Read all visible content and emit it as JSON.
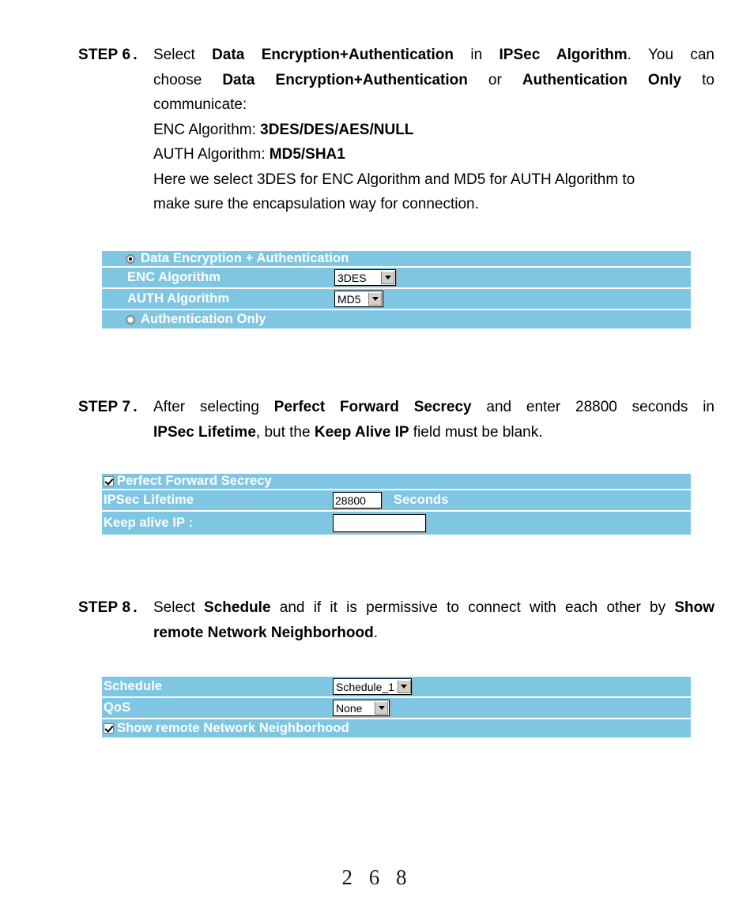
{
  "document": {
    "page_number": "2 6 8"
  },
  "steps": [
    {
      "label": "STEP 6",
      "separator": ".",
      "lines": [
        [
          {
            "t": "Select ",
            "b": false
          },
          {
            "t": "Data Encryption+Authentication",
            "b": true
          },
          {
            "t": " in ",
            "b": false
          },
          {
            "t": "IPSec Algorithm",
            "b": true
          },
          {
            "t": ". You can",
            "b": false
          }
        ],
        [
          {
            "t": "choose ",
            "b": false
          },
          {
            "t": "Data Encryption+Authentication",
            "b": true
          },
          {
            "t": " or ",
            "b": false
          },
          {
            "t": "Authentication Only",
            "b": true
          },
          {
            "t": " to",
            "b": false
          }
        ],
        [
          {
            "t": "communicate:",
            "b": false
          }
        ],
        [
          {
            "t": "ENC Algorithm: ",
            "b": false
          },
          {
            "t": "3DES/DES/AES/NULL",
            "b": true
          }
        ],
        [
          {
            "t": "AUTH Algorithm: ",
            "b": false
          },
          {
            "t": "MD5/SHA1",
            "b": true
          }
        ],
        [
          {
            "t": "Here we select 3DES for ENC Algorithm and MD5 for AUTH Algorithm to",
            "b": false
          }
        ],
        [
          {
            "t": "make sure the encapsulation way for connection.",
            "b": false
          }
        ]
      ]
    },
    {
      "label": "STEP 7",
      "separator": ".",
      "lines": [
        [
          {
            "t": "After selecting ",
            "b": false
          },
          {
            "t": "Perfect Forward Secrecy",
            "b": true
          },
          {
            "t": " and enter 28800 seconds in",
            "b": false
          }
        ],
        [
          {
            "t": "IPSec Lifetime",
            "b": true
          },
          {
            "t": ", but the ",
            "b": false
          },
          {
            "t": "Keep Alive IP",
            "b": true
          },
          {
            "t": " field must be blank.",
            "b": false
          }
        ]
      ]
    },
    {
      "label": "STEP 8",
      "separator": ".",
      "lines": [
        [
          {
            "t": "Select ",
            "b": false
          },
          {
            "t": "Schedule",
            "b": true
          },
          {
            "t": " and if it is permissive to connect with each other by ",
            "b": false
          },
          {
            "t": "Show",
            "b": true
          }
        ],
        [
          {
            "t": "remote Network Neighborhood",
            "b": true
          },
          {
            "t": ".",
            "b": false
          }
        ]
      ]
    }
  ],
  "panel_ipsec_algorithm": {
    "radio_enc_auth": {
      "label": "Data Encryption + Authentication",
      "selected": true,
      "icon": "radio-selected-icon"
    },
    "enc_algorithm": {
      "label": "ENC Algorithm",
      "value": "3DES",
      "icon": "chevron-down-icon"
    },
    "auth_algorithm": {
      "label": "AUTH Algorithm",
      "value": "MD5",
      "icon": "chevron-down-icon"
    },
    "radio_auth_only": {
      "label": "Authentication Only",
      "selected": false,
      "icon": "radio-unselected-icon"
    }
  },
  "panel_lifetime": {
    "pfs": {
      "label": "Perfect Forward Secrecy",
      "checked": true,
      "icon": "checkbox-checked-icon"
    },
    "ipsec_lifetime": {
      "label": "IPSec Lifetime",
      "value": "28800",
      "unit": "Seconds"
    },
    "keep_alive_ip": {
      "label": "Keep alive IP :",
      "value": "",
      "placeholder": ""
    }
  },
  "panel_schedule": {
    "schedule": {
      "label": "Schedule",
      "value": "Schedule_1",
      "icon": "chevron-down-icon"
    },
    "qos": {
      "label": "QoS",
      "value": "None",
      "icon": "chevron-down-icon"
    },
    "show_remote": {
      "label": "Show remote Network Neighborhood",
      "checked": true,
      "icon": "checkbox-checked-icon"
    }
  },
  "colors": {
    "panel_blue": "#7fc6e3",
    "panel_text": "#ffffff",
    "body_text": "#000000"
  }
}
